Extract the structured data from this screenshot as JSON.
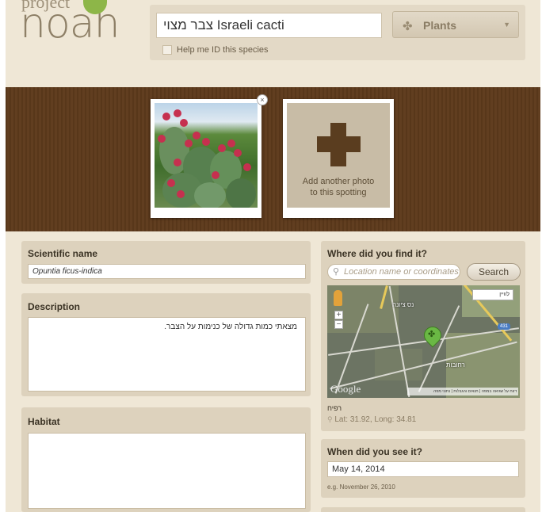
{
  "header": {
    "logo_small": "project",
    "logo_large": "noah",
    "title_value": "צבר מצוי Israeli cacti",
    "category": {
      "label": "Plants",
      "icon": "cactus-icon"
    },
    "help_label": "Help me ID this species"
  },
  "photos": {
    "add_label_line1": "Add another photo",
    "add_label_line2": "to this spotting",
    "remove_symbol": "×"
  },
  "form": {
    "scientific_name": {
      "title": "Scientific name",
      "value": "Opuntia ficus-indica"
    },
    "description": {
      "title": "Description",
      "value": "מצאתי כמות גדולה של כנימות על הצבר."
    },
    "habitat": {
      "title": "Habitat",
      "value": ""
    },
    "location": {
      "title": "Where did you find it?",
      "placeholder": "Location name or coordinates",
      "search_label": "Search",
      "place_name": "רפיח",
      "coords": "Lat: 31.92, Long: 34.81",
      "map": {
        "google_label": "Google",
        "maptype_label": "לוויין",
        "footer": "דווח על שגיאה במפה | תנאים והגבלות | נתוני מפה",
        "road_badge": "431",
        "towns": [
          "נס ציונה",
          "רחובות"
        ]
      }
    },
    "date": {
      "title": "When did you see it?",
      "value": "May 14, 2014",
      "hint": "e.g. November 26, 2010"
    }
  },
  "colors": {
    "header_bg": "#efe7d6",
    "strip_bg": "#5e3a1c",
    "panel_bg": "#ddd2bd",
    "accent_green": "#6ab844"
  }
}
